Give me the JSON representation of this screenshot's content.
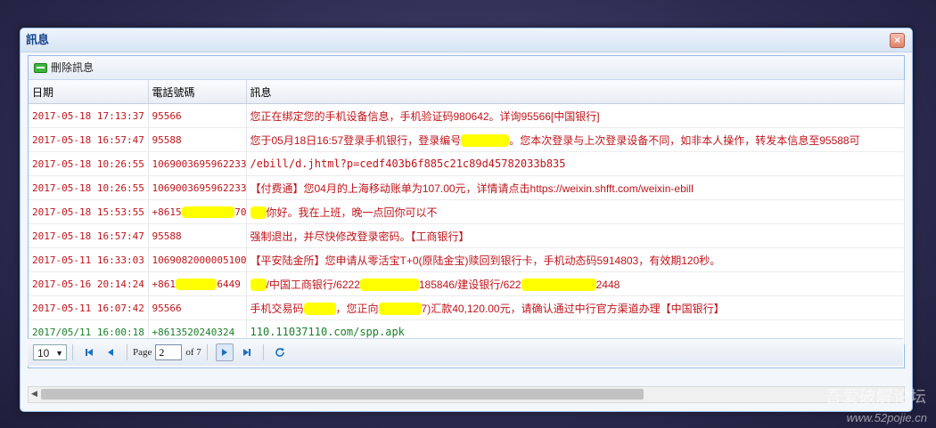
{
  "window": {
    "title": "訊息"
  },
  "toolbar": {
    "delete_label": "刪除訊息"
  },
  "grid": {
    "columns": [
      "日期",
      "電話號碼",
      "訊息"
    ],
    "rows": [
      {
        "date": "2017-05-18 17:13:37",
        "phone": "95566",
        "message": "您正在绑定您的手机设备信息，手机验证码980642。详询95566[中国银行]"
      },
      {
        "date": "2017-05-18 16:57:47",
        "phone": "95588",
        "message": "您于05月18日16:57登录手机银行，登录编号",
        "message_tail": "。您本次登录与上次登录设备不同，如非本人操作，转发本信息至95588可"
      },
      {
        "date": "2017-05-18 10:26:55",
        "phone": "1069003695962233",
        "message": "/ebill/d.jhtml?p=cedf403b6f885c21c89d45782033b835"
      },
      {
        "date": "2017-05-18 10:26:55",
        "phone": "1069003695962233",
        "message": "【付费通】您04月的上海移动账单为107.00元，详情请点击https://weixin.shfft.com/weixin-ebill"
      },
      {
        "date": "2017-05-18 15:53:55",
        "phone_pre": "+8615",
        "phone_post": "70",
        "message": "你好。我在上班，晚一点回你可以不"
      },
      {
        "date": "2017-05-18 16:57:47",
        "phone": "95588",
        "message": "强制退出，并尽快修改登录密码。【工商银行】"
      },
      {
        "date": "2017-05-11 16:33:03",
        "phone": "10690820000051003",
        "message": "【平安陆金所】您申请从零活宝T+0(原陆金宝)赎回到银行卡，手机动态码5914803，有效期120秒。"
      },
      {
        "date": "2017-05-16 20:14:24",
        "phone_pre": "+861",
        "phone_post": "6449",
        "message": "/中国工商银行/6222",
        "message_mid": "185846/建设银行/622",
        "message_tail": "2448"
      },
      {
        "date": "2017-05-11 16:07:42",
        "phone": "95566",
        "message": "手机交易码",
        "message_mid": "，您正向",
        "message_tail": "7)汇款40,120.00元，请确认通过中行官方渠道办理【中国银行】"
      },
      {
        "date": "2017/05/11 16:00:18",
        "phone": "+8613520240324",
        "message": "110.11037110.com/spp.apk"
      }
    ]
  },
  "pager": {
    "page_size": "10",
    "page_label": "Page",
    "current_page": "2",
    "of_label": "of 7"
  },
  "watermark": {
    "line1": "吾爱破解论坛",
    "line2": "www.52pojie.cn"
  },
  "colors": {
    "text_red": "#c0141b",
    "text_green": "#1b7e2a",
    "redaction": "#ffff00"
  }
}
